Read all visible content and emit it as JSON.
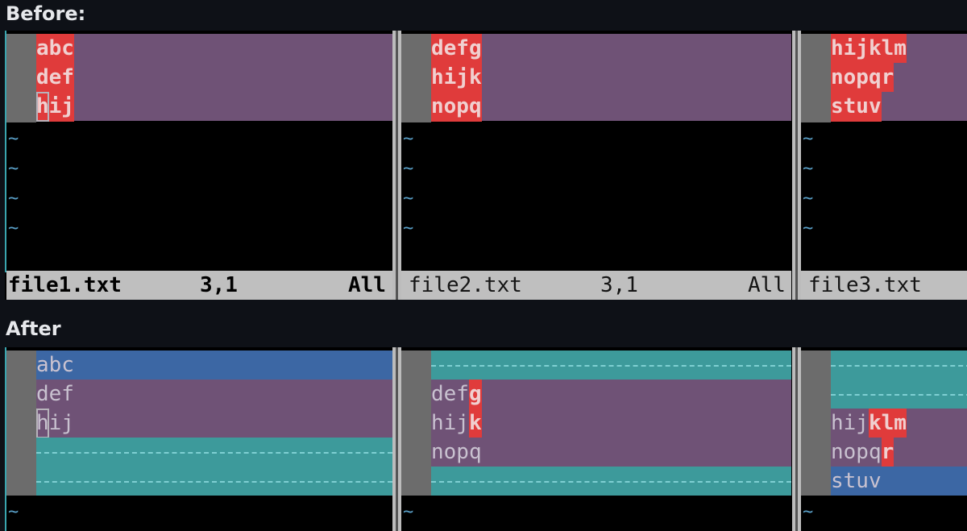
{
  "labels": {
    "before": "Before:",
    "after": "After"
  },
  "before": {
    "panes": [
      {
        "file": "file1.txt",
        "pos": "3,1",
        "scroll": "All",
        "lines": [
          [
            {
              "t": "abc",
              "c": "red"
            }
          ],
          [
            {
              "t": "def",
              "c": "red"
            }
          ],
          [
            {
              "t": "h",
              "c": "red-cursor"
            },
            {
              "t": "ij",
              "c": "red"
            }
          ]
        ]
      },
      {
        "file": "file2.txt",
        "pos": "3,1",
        "scroll": "All",
        "lines": [
          [
            {
              "t": "defg",
              "c": "red"
            }
          ],
          [
            {
              "t": "hijk",
              "c": "red"
            }
          ],
          [
            {
              "t": "nopq",
              "c": "red"
            }
          ]
        ]
      },
      {
        "file": "file3.txt",
        "pos": "",
        "scroll": "",
        "lines": [
          [
            {
              "t": "hijklm",
              "c": "red"
            }
          ],
          [
            {
              "t": "nopqr",
              "c": "red"
            }
          ],
          [
            {
              "t": "stuv",
              "c": "red"
            }
          ]
        ]
      }
    ]
  },
  "after": {
    "panes": [
      {
        "rows": [
          {
            "kind": "added",
            "segs": [
              {
                "t": "abc",
                "c": ""
              }
            ]
          },
          {
            "kind": "changed",
            "segs": [
              {
                "t": "def",
                "c": ""
              }
            ]
          },
          {
            "kind": "changed",
            "segs": [
              {
                "t": "h",
                "c": "cursor"
              },
              {
                "t": "ij",
                "c": ""
              }
            ]
          },
          {
            "kind": "filler",
            "segs": []
          },
          {
            "kind": "filler",
            "segs": []
          }
        ]
      },
      {
        "rows": [
          {
            "kind": "filler",
            "segs": []
          },
          {
            "kind": "changed",
            "segs": [
              {
                "t": "def",
                "c": ""
              },
              {
                "t": "g",
                "c": "red"
              }
            ]
          },
          {
            "kind": "changed",
            "segs": [
              {
                "t": "hij",
                "c": ""
              },
              {
                "t": "k",
                "c": "red"
              }
            ]
          },
          {
            "kind": "changed",
            "segs": [
              {
                "t": "nopq",
                "c": ""
              }
            ]
          },
          {
            "kind": "filler",
            "segs": []
          }
        ]
      },
      {
        "rows": [
          {
            "kind": "filler",
            "segs": []
          },
          {
            "kind": "filler",
            "segs": []
          },
          {
            "kind": "changed",
            "segs": [
              {
                "t": "hij",
                "c": ""
              },
              {
                "t": "klm",
                "c": "red"
              }
            ]
          },
          {
            "kind": "changed",
            "segs": [
              {
                "t": "nopq",
                "c": ""
              },
              {
                "t": "r",
                "c": "red"
              }
            ]
          },
          {
            "kind": "added",
            "segs": [
              {
                "t": "stuv",
                "c": ""
              }
            ]
          }
        ]
      }
    ]
  },
  "tilde": "~",
  "colors": {
    "changed": "#6f5276",
    "added": "#3c67a4",
    "filler": "#3d9a9b",
    "text_highlight": "#e03b3b",
    "gutter": "#6c6c6c",
    "status": "#bfbfbf"
  }
}
